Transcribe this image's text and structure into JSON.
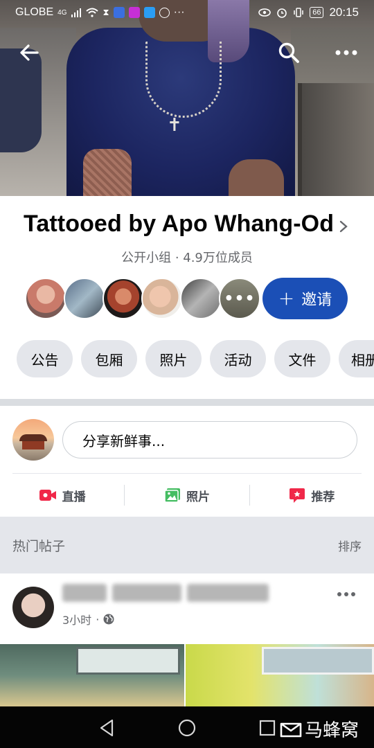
{
  "status_bar": {
    "carrier": "GLOBE",
    "network": "4G",
    "battery": "66",
    "time": "20:15"
  },
  "header": {
    "back_icon": "arrow-left-icon",
    "search_icon": "search-icon",
    "more_icon": "more-horizontal-icon"
  },
  "group": {
    "name": "Tattooed by Apo Whang-Od",
    "meta": "公开小组 · 4.9万位成员",
    "invite_label": "邀请",
    "member_colors": [
      "#c97a6a",
      "#5a6f8a",
      "#a5432d",
      "#d9b59a",
      "#6f6f6f",
      "#5b5a4e"
    ]
  },
  "tabs": [
    "公告",
    "包厢",
    "照片",
    "活动",
    "文件",
    "相册"
  ],
  "composer": {
    "placeholder": "分享新鲜事...",
    "actions": [
      {
        "label": "直播",
        "icon": "live-video-icon",
        "color": "#f02849"
      },
      {
        "label": "照片",
        "icon": "photo-icon",
        "color": "#45bd62"
      },
      {
        "label": "推荐",
        "icon": "recommend-icon",
        "color": "#f02849"
      }
    ]
  },
  "feed": {
    "section_title": "热门帖子",
    "sort_label": "排序"
  },
  "post": {
    "time": "3小时",
    "privacy_icon": "globe-icon"
  },
  "watermark": {
    "text": "马蜂窝"
  },
  "colors": {
    "primary": "#1b4fb6",
    "pill_bg": "#e4e6eb",
    "secondary_text": "#65676b"
  }
}
